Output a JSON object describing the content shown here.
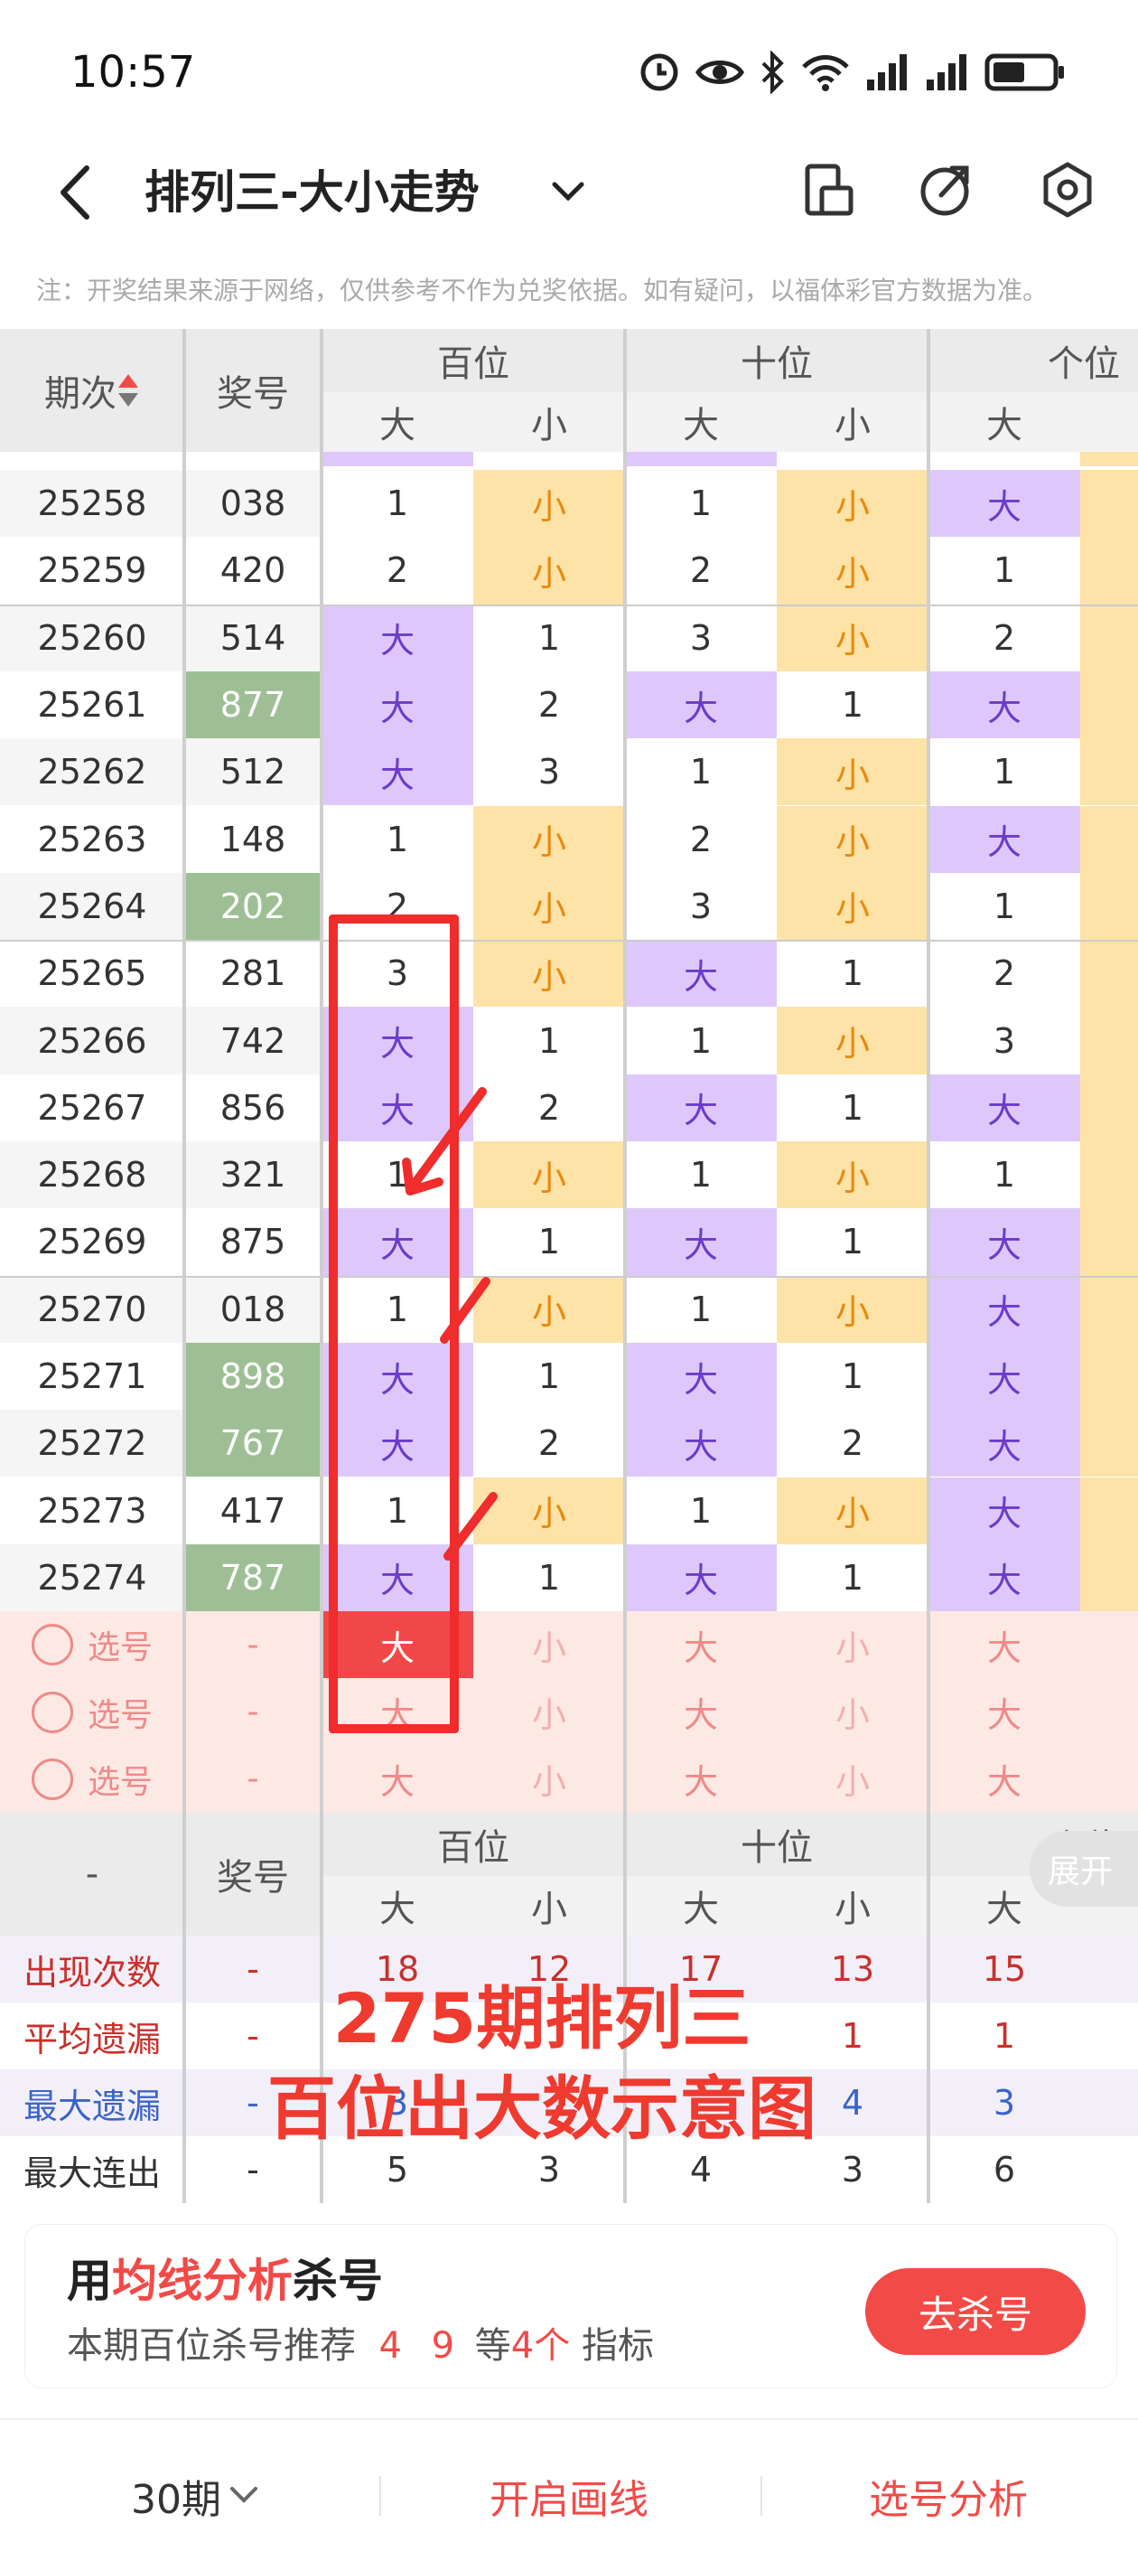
{
  "status_bar": {
    "time": "10:57"
  },
  "header": {
    "title": "排列三-大小走势"
  },
  "notice": "注：开奖结果来源于网络，仅供参考不作为兑奖依据。如有疑问，以福体彩官方数据为准。",
  "table_header": {
    "period": "期次",
    "number": "奖号",
    "groups": [
      "百位",
      "十位",
      "个位"
    ],
    "sub_labels": [
      "大",
      "小",
      "大",
      "小",
      "大"
    ]
  },
  "rows": [
    {
      "period": "25258",
      "number": "038",
      "hl": false,
      "cells": [
        "1",
        "小",
        "1",
        "小",
        "大"
      ]
    },
    {
      "period": "25259",
      "number": "420",
      "hl": false,
      "cells": [
        "2",
        "小",
        "2",
        "小",
        "1"
      ]
    },
    {
      "period": "25260",
      "number": "514",
      "hl": false,
      "cells": [
        "大",
        "1",
        "3",
        "小",
        "2"
      ]
    },
    {
      "period": "25261",
      "number": "877",
      "hl": true,
      "cells": [
        "大",
        "2",
        "大",
        "1",
        "大"
      ]
    },
    {
      "period": "25262",
      "number": "512",
      "hl": false,
      "cells": [
        "大",
        "3",
        "1",
        "小",
        "1"
      ]
    },
    {
      "period": "25263",
      "number": "148",
      "hl": false,
      "cells": [
        "1",
        "小",
        "2",
        "小",
        "大"
      ]
    },
    {
      "period": "25264",
      "number": "202",
      "hl": true,
      "cells": [
        "2",
        "小",
        "3",
        "小",
        "1"
      ]
    },
    {
      "period": "25265",
      "number": "281",
      "hl": false,
      "cells": [
        "3",
        "小",
        "大",
        "1",
        "2"
      ]
    },
    {
      "period": "25266",
      "number": "742",
      "hl": false,
      "cells": [
        "大",
        "1",
        "1",
        "小",
        "3"
      ]
    },
    {
      "period": "25267",
      "number": "856",
      "hl": false,
      "cells": [
        "大",
        "2",
        "大",
        "1",
        "大"
      ]
    },
    {
      "period": "25268",
      "number": "321",
      "hl": false,
      "cells": [
        "1",
        "小",
        "1",
        "小",
        "1"
      ]
    },
    {
      "period": "25269",
      "number": "875",
      "hl": false,
      "cells": [
        "大",
        "1",
        "大",
        "1",
        "大"
      ]
    },
    {
      "period": "25270",
      "number": "018",
      "hl": false,
      "cells": [
        "1",
        "小",
        "1",
        "小",
        "大"
      ]
    },
    {
      "period": "25271",
      "number": "898",
      "hl": true,
      "cells": [
        "大",
        "1",
        "大",
        "1",
        "大"
      ]
    },
    {
      "period": "25272",
      "number": "767",
      "hl": true,
      "cells": [
        "大",
        "2",
        "大",
        "2",
        "大"
      ]
    },
    {
      "period": "25273",
      "number": "417",
      "hl": false,
      "cells": [
        "1",
        "小",
        "1",
        "小",
        "大"
      ]
    },
    {
      "period": "25274",
      "number": "787",
      "hl": true,
      "cells": [
        "大",
        "1",
        "大",
        "1",
        "大"
      ]
    }
  ],
  "picker_rows": [
    {
      "label": "选号",
      "number": "-",
      "cells": [
        "大",
        "小",
        "大",
        "小",
        "大"
      ],
      "selected": 0
    },
    {
      "label": "选号",
      "number": "-",
      "cells": [
        "大",
        "小",
        "大",
        "小",
        "大"
      ],
      "selected": -1
    },
    {
      "label": "选号",
      "number": "-",
      "cells": [
        "大",
        "小",
        "大",
        "小",
        "大"
      ],
      "selected": -1
    }
  ],
  "footer_header": {
    "period": "-",
    "number": "奖号",
    "groups": [
      "百位",
      "十位",
      "个位"
    ],
    "sub_labels": [
      "大",
      "小",
      "大",
      "小",
      "大"
    ]
  },
  "stats": [
    {
      "label": "出现次数",
      "number": "-",
      "values": [
        "18",
        "12",
        "17",
        "13",
        "15"
      ]
    },
    {
      "label": "平均遗漏",
      "number": "-",
      "values": [
        "",
        "",
        "",
        "1",
        "1"
      ]
    },
    {
      "label": "最大遗漏",
      "number": "-",
      "values": [
        "3",
        "",
        "",
        "4",
        "3"
      ]
    },
    {
      "label": "最大连出",
      "number": "-",
      "values": [
        "5",
        "3",
        "4",
        "3",
        "6"
      ]
    }
  ],
  "expand_label": "展开",
  "annotation": {
    "line1": "275期排列三",
    "line2": "百位出大数示意图"
  },
  "card": {
    "title_pre": "用",
    "title_hl": "均线分析",
    "title_post": "杀号",
    "sub_pre": "本期百位杀号推荐",
    "sub_nums": "4 9",
    "sub_mid": "等",
    "sub_count": "4个",
    "sub_post": "指标",
    "button": "去杀号"
  },
  "bottom_bar": {
    "periods": "30期",
    "draw": "开启画线",
    "analysis": "选号分析"
  },
  "colors": {
    "big_bg": "#dec8fb",
    "big_text": "#6b3cc9",
    "small_bg": "#fde3a7",
    "small_text": "#e88a0e",
    "accent": "#f24a47",
    "highlight_number_bg": "#9ebf95"
  }
}
